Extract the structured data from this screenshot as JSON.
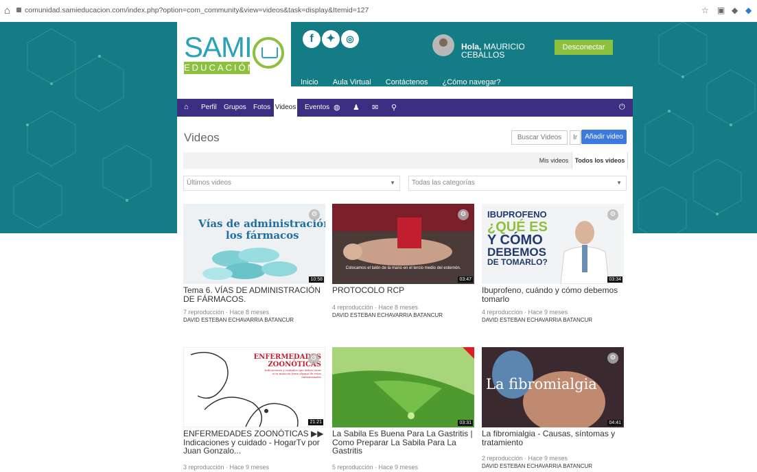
{
  "browser": {
    "url": "comunidad.samieducacion.com/index.php?option=com_community&view=videos&task=display&Itemid=127"
  },
  "header": {
    "logo_text": "SAMI",
    "logo_subtext": "EDUCACIÓN",
    "social": [
      "f",
      "t",
      "ig"
    ],
    "greeting_bold": "Hola,",
    "greeting_name_line1": "MAURICIO",
    "greeting_name_line2": "CEBALLOS",
    "disconnect_label": "Desconectar",
    "nav": [
      "Inicio",
      "Aula Virtual",
      "Contáctenos",
      "¿Cómo navegar?"
    ]
  },
  "community_nav": {
    "items": [
      "Perfil",
      "Grupos",
      "Fotos",
      "Videos",
      "Eventos"
    ],
    "active": "Videos"
  },
  "page": {
    "title": "Videos",
    "search_placeholder": "Buscar Videos",
    "go_label": "Ir",
    "add_label": "Añadir video",
    "tabs": [
      "Mis videos",
      "Todos los videos"
    ],
    "sort_select": "Últimos videos",
    "category_select": "Todas las categorías"
  },
  "videos": [
    {
      "thumb_text_1": "Vías de administración de",
      "thumb_text_2": "los fármacos",
      "duration": "10:58",
      "title": "Tema 6. VÍAS DE ADMINISTRACIÓN DE FÁRMACOS.",
      "meta": "7 reproducción · Hace 8 meses",
      "author": "DAVID ESTEBAN ECHAVARRIA BATANCUR"
    },
    {
      "thumb_caption": "Colocamos el talón de la mano en el tercio medio del esternón.",
      "duration": "03:47",
      "title": "PROTOCOLO RCP",
      "meta": "4 reproducción · Hace 8 meses",
      "author": "DAVID ESTEBAN ECHAVARRIA BATANCUR"
    },
    {
      "thumb_lines": [
        "IBUPROFENO",
        "¿QUÉ ES",
        "Y CÓMO",
        "DEBEMOS",
        "DE TOMARLO?"
      ],
      "duration": "03:34",
      "title": "Ibuprofeno, cuándo y cómo debemos tomarlo",
      "meta": "4 reproducción · Hace 9 meses",
      "author": "DAVID ESTEBAN ECHAVARRIA BATANCUR"
    },
    {
      "thumb_lines": [
        "ENFERMEDADES",
        "ZOONÓTICAS",
        "Indicaciones y cuidados que debes tener",
        "si tu mascota tiene alguna de estas",
        "enfermedades"
      ],
      "duration": "21:21",
      "title": "ENFERMEDADES ZOONÓTICAS ▶▶ Indicaciones y cuidado - HogarTv por Juan Gonzalo...",
      "meta": "3 reproducción · Hace 9 meses",
      "author": ""
    },
    {
      "duration": "03:31",
      "title": "La Sabila Es Buena Para La Gastritis | Como Preparar La Sabila Para La Gastritis",
      "meta": "5 reproducción · Hace 9 meses",
      "author": ""
    },
    {
      "thumb_text": "La fibromialgia",
      "duration": "04:41",
      "title": "La fibromialgia - Causas, síntomas y tratamiento",
      "meta": "2 reproducción · Hace 9 meses",
      "author": "DAVID ESTEBAN ECHAVARRIA BATANCUR"
    }
  ],
  "colors": {
    "teal": "#137c85",
    "green": "#8dc03f",
    "purple": "#3b2e82",
    "blue": "#3c7bdc"
  }
}
